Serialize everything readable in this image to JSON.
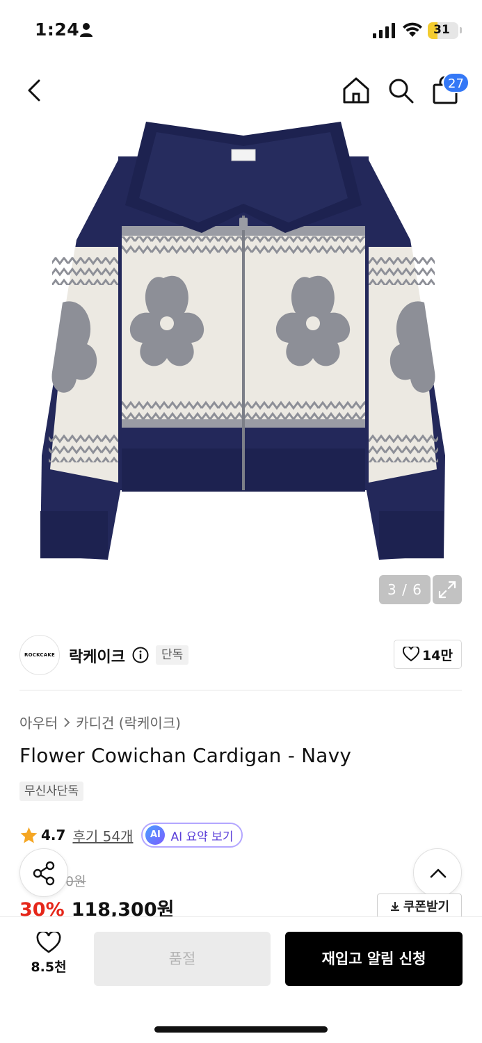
{
  "status_bar": {
    "time": "1:24",
    "battery": "31",
    "battery_level": 0.31
  },
  "header": {
    "cart_count": "27"
  },
  "gallery": {
    "counter": "3 / 6"
  },
  "brand": {
    "logo_text": "ROCKCAKE",
    "name": "락케이크",
    "tag": "단독",
    "likes": "14만"
  },
  "breadcrumb": {
    "category": "아우터",
    "subcategory": "카디건 (락케이크)"
  },
  "product": {
    "title": "Flower Cowichan Cardigan - Navy",
    "exclusive_tag": "무신사단독",
    "rating": "4.7",
    "reviews": "후기 54개",
    "ai_badge": "AI",
    "ai_summary": "AI 요약 보기",
    "original_price": "0원",
    "discount": "30%",
    "sale_price": "118,300원",
    "coupon": "쿠폰받기"
  },
  "bottom_bar": {
    "wish_count": "8.5천",
    "soldout": "품절",
    "restock": "재입고 알림 신청"
  },
  "colors": {
    "accent_blue": "#3478f6",
    "discount_red": "#e5271a",
    "star": "#f5a623",
    "navy": "#1f2454"
  }
}
